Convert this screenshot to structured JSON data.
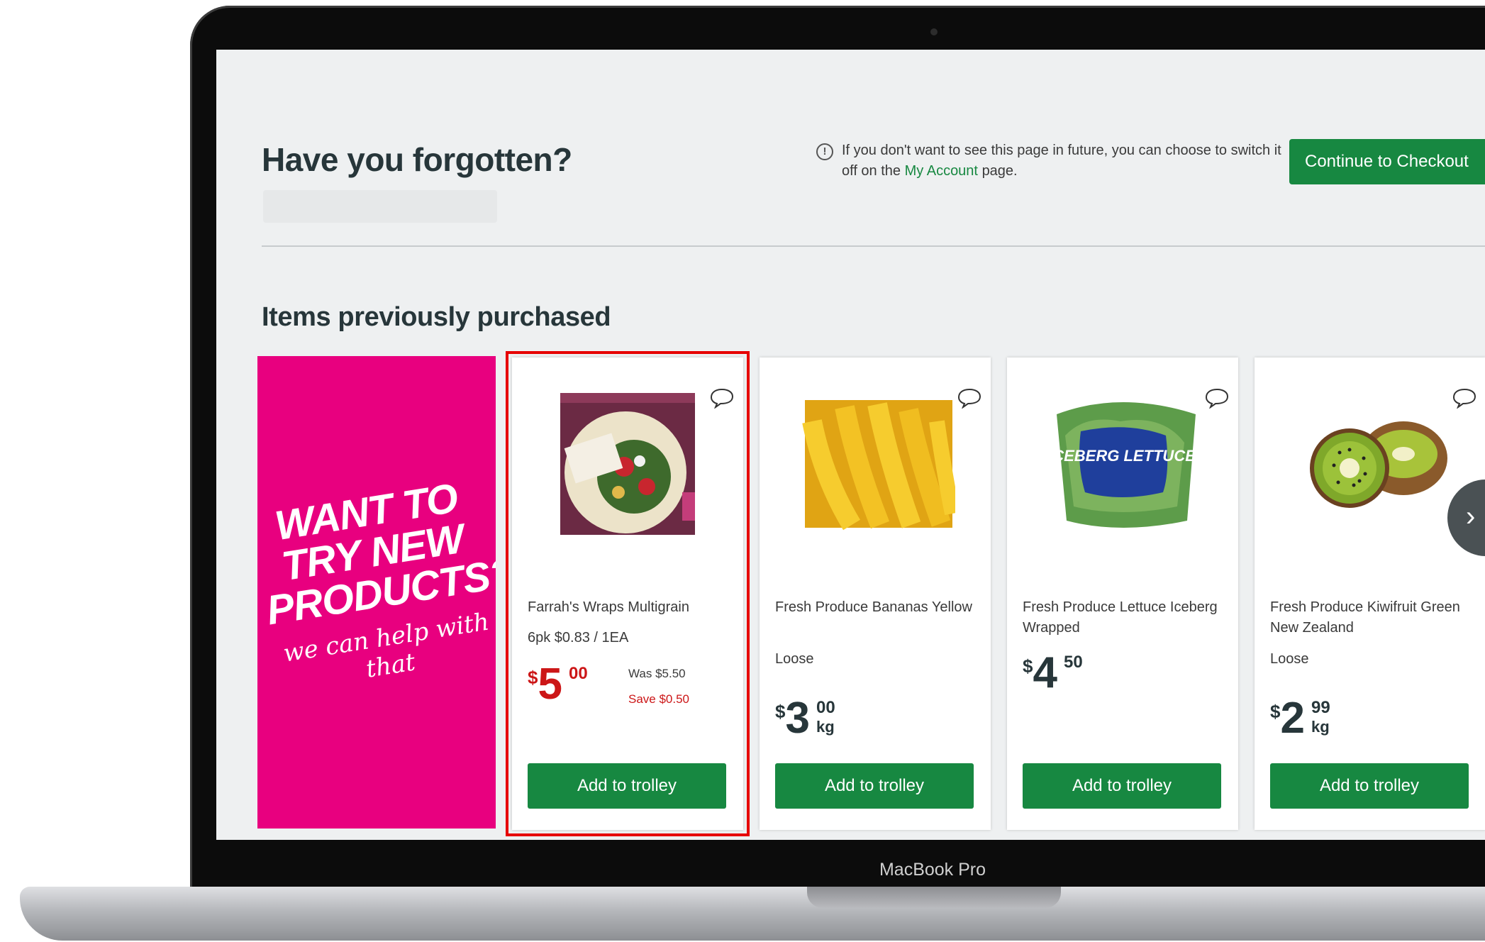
{
  "device": {
    "label": "MacBook Pro"
  },
  "page": {
    "title": "Have you forgotten?",
    "notice": {
      "text_before": "If you don't want to see this page in future, you can choose to switch it off on the",
      "link": "My Account",
      "text_after": "page."
    },
    "checkout_button": "Continue to Checkout",
    "section_title": "Items previously purchased"
  },
  "promo": {
    "headline": "WANT TO TRY NEW PRODUCTS?",
    "subline": "we can help with that",
    "color": "#e8007f"
  },
  "products": [
    {
      "name": "Farrah's Wraps Multigrain",
      "detail": "6pk  $0.83 / 1EA",
      "price_symbol": "$",
      "price_whole": "5",
      "price_cents": "00",
      "was": "Was $5.50",
      "save": "Save $0.50",
      "button": "Add to trolley",
      "highlighted": true,
      "image": "wraps-package"
    },
    {
      "name": "Fresh Produce Bananas Yellow",
      "detail": "Loose",
      "price_symbol": "$",
      "price_whole": "3",
      "price_cents": "00",
      "unit": "kg",
      "button": "Add to trolley",
      "image": "bananas"
    },
    {
      "name": "Fresh Produce Lettuce Iceberg Wrapped",
      "price_symbol": "$",
      "price_whole": "4",
      "price_cents": "50",
      "button": "Add to trolley",
      "image": "iceberg-lettuce",
      "image_text": "ICEBERG LETTUCE"
    },
    {
      "name": "Fresh Produce Kiwifruit Green New Zealand",
      "detail": "Loose",
      "price_symbol": "$",
      "price_whole": "2",
      "price_cents": "99",
      "unit": "kg",
      "button": "Add to trolley",
      "image": "kiwifruit"
    }
  ],
  "colors": {
    "primary_green": "#178841",
    "sale_red": "#cc1617",
    "highlight": "#e60000"
  }
}
